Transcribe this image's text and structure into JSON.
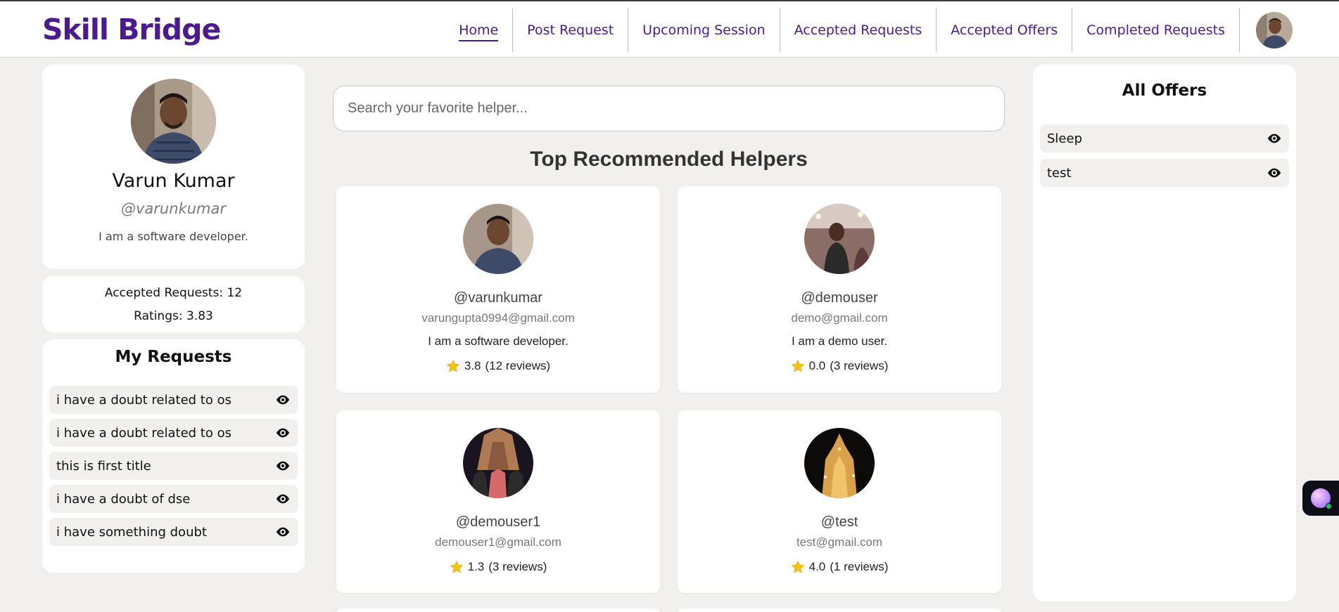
{
  "app": {
    "title": "Skill Bridge"
  },
  "nav": {
    "items": [
      {
        "label": "Home",
        "active": true
      },
      {
        "label": "Post Request"
      },
      {
        "label": "Upcoming Session"
      },
      {
        "label": "Accepted Requests"
      },
      {
        "label": "Accepted Offers"
      },
      {
        "label": "Completed Requests"
      }
    ]
  },
  "profile": {
    "name": "Varun Kumar",
    "handle": "@varunkumar",
    "bio": "I am a software developer.",
    "accepted_requests": "Accepted Requests: 12",
    "ratings": "Ratings: 3.83"
  },
  "my_requests": {
    "title": "My Requests",
    "items": [
      {
        "label": "i have a doubt related to os"
      },
      {
        "label": "i have a doubt related to os"
      },
      {
        "label": "this is first title"
      },
      {
        "label": "i have a doubt of dse"
      },
      {
        "label": "i have something doubt"
      }
    ]
  },
  "search": {
    "placeholder": "Search your favorite helper..."
  },
  "main": {
    "title": "Top Recommended Helpers"
  },
  "helpers": [
    {
      "handle": "@varunkumar",
      "email": "varungupta0994@gmail.com",
      "bio": "I am a software developer.",
      "rating": "3.8",
      "reviews": "(12 reviews)"
    },
    {
      "handle": "@demouser",
      "email": "demo@gmail.com",
      "bio": "I am a demo user.",
      "rating": "0.0",
      "reviews": "(3 reviews)"
    },
    {
      "handle": "@demouser1",
      "email": "demouser1@gmail.com",
      "bio": "",
      "rating": "1.3",
      "reviews": "(3 reviews)"
    },
    {
      "handle": "@test",
      "email": "test@gmail.com",
      "bio": "",
      "rating": "4.0",
      "reviews": "(1 reviews)"
    }
  ],
  "offers": {
    "title": "All Offers",
    "items": [
      {
        "label": "Sleep"
      },
      {
        "label": "test"
      }
    ]
  },
  "colors": {
    "brand": "#4b1a8c",
    "background": "#f1f0ee",
    "star": "#f4c21b"
  }
}
